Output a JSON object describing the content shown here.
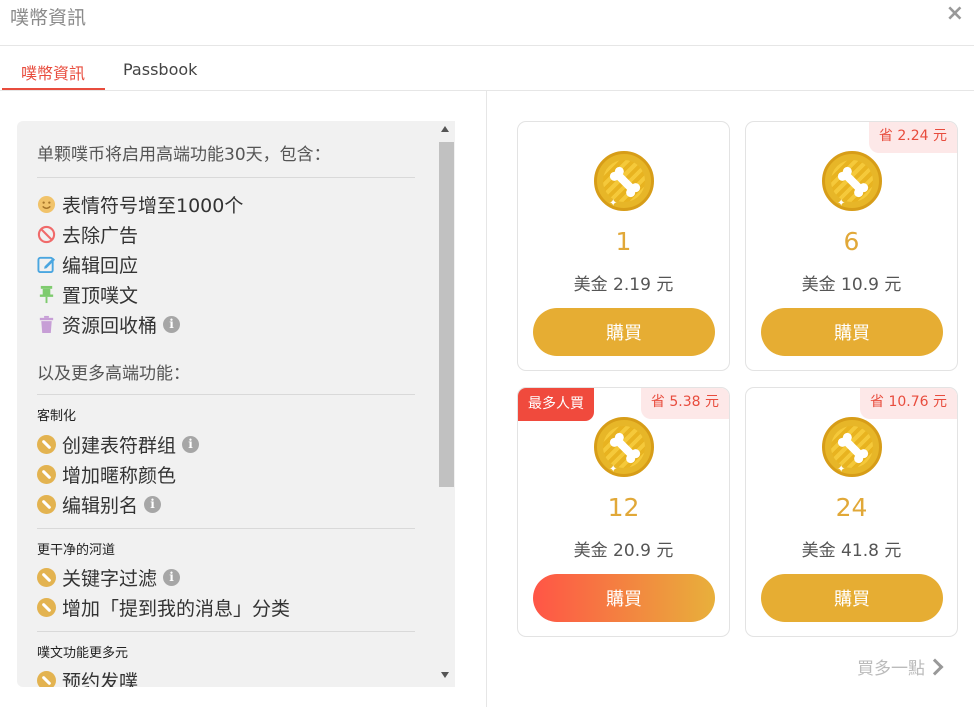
{
  "window": {
    "title": "噗幣資訊",
    "close_icon": "×"
  },
  "tabs": [
    {
      "label": "噗幣資訊",
      "active": true
    },
    {
      "label": "Passbook",
      "active": false
    }
  ],
  "features": {
    "intro": "单颗噗币将启用高端功能30天，包含：",
    "basic": [
      {
        "label": "表情符号增至1000个",
        "icon": "smile-icon"
      },
      {
        "label": "去除广告",
        "icon": "no-ads-icon"
      },
      {
        "label": "编辑回应",
        "icon": "edit-icon"
      },
      {
        "label": "置顶噗文",
        "icon": "pin-icon"
      },
      {
        "label": "资源回收桶",
        "icon": "trash-icon",
        "info": true
      }
    ],
    "more_heading": "以及更多高端功能：",
    "sections": [
      {
        "heading": "客制化",
        "items": [
          {
            "label": "创建表符群组",
            "info": true
          },
          {
            "label": "增加暱称颜色",
            "info": false
          },
          {
            "label": "编辑别名",
            "info": true
          }
        ]
      },
      {
        "heading": "更干净的河道",
        "items": [
          {
            "label": "关键字过滤",
            "info": true
          },
          {
            "label": "增加「提到我的消息」分类",
            "info": false
          }
        ]
      },
      {
        "heading": "噗文功能更多元",
        "items": [
          {
            "label": "预约发噗",
            "info": false
          }
        ]
      }
    ],
    "info_glyph": "i"
  },
  "packages": [
    {
      "qty": "1",
      "price": "美金 2.19 元",
      "buy": "購買",
      "save": "",
      "badge": ""
    },
    {
      "qty": "6",
      "price": "美金 10.9 元",
      "buy": "購買",
      "save": "省 2.24 元",
      "badge": ""
    },
    {
      "qty": "12",
      "price": "美金 20.9 元",
      "buy": "購買",
      "save": "省 5.38 元",
      "badge": "最多人買"
    },
    {
      "qty": "24",
      "price": "美金 41.8 元",
      "buy": "購買",
      "save": "省 10.76 元",
      "badge": ""
    }
  ],
  "more_link": "買多一點",
  "colors": {
    "accent": "#e84c3d",
    "gold": "#e6ad33",
    "panel_bg": "#f1f1f1"
  }
}
